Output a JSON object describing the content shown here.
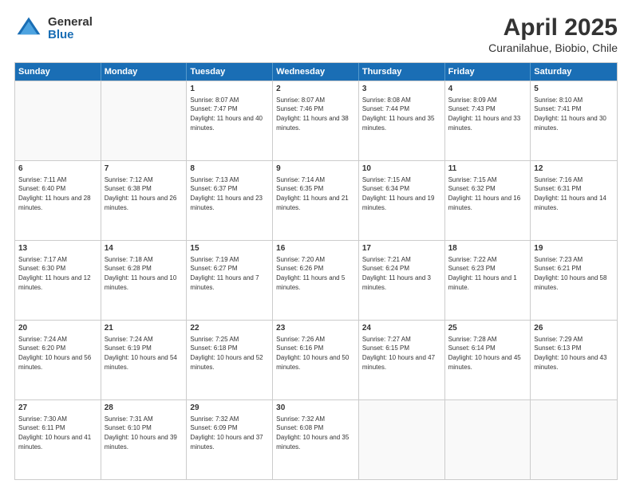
{
  "logo": {
    "general": "General",
    "blue": "Blue"
  },
  "title": "April 2025",
  "subtitle": "Curanilahue, Biobio, Chile",
  "header_days": [
    "Sunday",
    "Monday",
    "Tuesday",
    "Wednesday",
    "Thursday",
    "Friday",
    "Saturday"
  ],
  "weeks": [
    [
      {
        "day": "",
        "info": ""
      },
      {
        "day": "",
        "info": ""
      },
      {
        "day": "1",
        "info": "Sunrise: 8:07 AM\nSunset: 7:47 PM\nDaylight: 11 hours and 40 minutes."
      },
      {
        "day": "2",
        "info": "Sunrise: 8:07 AM\nSunset: 7:46 PM\nDaylight: 11 hours and 38 minutes."
      },
      {
        "day": "3",
        "info": "Sunrise: 8:08 AM\nSunset: 7:44 PM\nDaylight: 11 hours and 35 minutes."
      },
      {
        "day": "4",
        "info": "Sunrise: 8:09 AM\nSunset: 7:43 PM\nDaylight: 11 hours and 33 minutes."
      },
      {
        "day": "5",
        "info": "Sunrise: 8:10 AM\nSunset: 7:41 PM\nDaylight: 11 hours and 30 minutes."
      }
    ],
    [
      {
        "day": "6",
        "info": "Sunrise: 7:11 AM\nSunset: 6:40 PM\nDaylight: 11 hours and 28 minutes."
      },
      {
        "day": "7",
        "info": "Sunrise: 7:12 AM\nSunset: 6:38 PM\nDaylight: 11 hours and 26 minutes."
      },
      {
        "day": "8",
        "info": "Sunrise: 7:13 AM\nSunset: 6:37 PM\nDaylight: 11 hours and 23 minutes."
      },
      {
        "day": "9",
        "info": "Sunrise: 7:14 AM\nSunset: 6:35 PM\nDaylight: 11 hours and 21 minutes."
      },
      {
        "day": "10",
        "info": "Sunrise: 7:15 AM\nSunset: 6:34 PM\nDaylight: 11 hours and 19 minutes."
      },
      {
        "day": "11",
        "info": "Sunrise: 7:15 AM\nSunset: 6:32 PM\nDaylight: 11 hours and 16 minutes."
      },
      {
        "day": "12",
        "info": "Sunrise: 7:16 AM\nSunset: 6:31 PM\nDaylight: 11 hours and 14 minutes."
      }
    ],
    [
      {
        "day": "13",
        "info": "Sunrise: 7:17 AM\nSunset: 6:30 PM\nDaylight: 11 hours and 12 minutes."
      },
      {
        "day": "14",
        "info": "Sunrise: 7:18 AM\nSunset: 6:28 PM\nDaylight: 11 hours and 10 minutes."
      },
      {
        "day": "15",
        "info": "Sunrise: 7:19 AM\nSunset: 6:27 PM\nDaylight: 11 hours and 7 minutes."
      },
      {
        "day": "16",
        "info": "Sunrise: 7:20 AM\nSunset: 6:26 PM\nDaylight: 11 hours and 5 minutes."
      },
      {
        "day": "17",
        "info": "Sunrise: 7:21 AM\nSunset: 6:24 PM\nDaylight: 11 hours and 3 minutes."
      },
      {
        "day": "18",
        "info": "Sunrise: 7:22 AM\nSunset: 6:23 PM\nDaylight: 11 hours and 1 minute."
      },
      {
        "day": "19",
        "info": "Sunrise: 7:23 AM\nSunset: 6:21 PM\nDaylight: 10 hours and 58 minutes."
      }
    ],
    [
      {
        "day": "20",
        "info": "Sunrise: 7:24 AM\nSunset: 6:20 PM\nDaylight: 10 hours and 56 minutes."
      },
      {
        "day": "21",
        "info": "Sunrise: 7:24 AM\nSunset: 6:19 PM\nDaylight: 10 hours and 54 minutes."
      },
      {
        "day": "22",
        "info": "Sunrise: 7:25 AM\nSunset: 6:18 PM\nDaylight: 10 hours and 52 minutes."
      },
      {
        "day": "23",
        "info": "Sunrise: 7:26 AM\nSunset: 6:16 PM\nDaylight: 10 hours and 50 minutes."
      },
      {
        "day": "24",
        "info": "Sunrise: 7:27 AM\nSunset: 6:15 PM\nDaylight: 10 hours and 47 minutes."
      },
      {
        "day": "25",
        "info": "Sunrise: 7:28 AM\nSunset: 6:14 PM\nDaylight: 10 hours and 45 minutes."
      },
      {
        "day": "26",
        "info": "Sunrise: 7:29 AM\nSunset: 6:13 PM\nDaylight: 10 hours and 43 minutes."
      }
    ],
    [
      {
        "day": "27",
        "info": "Sunrise: 7:30 AM\nSunset: 6:11 PM\nDaylight: 10 hours and 41 minutes."
      },
      {
        "day": "28",
        "info": "Sunrise: 7:31 AM\nSunset: 6:10 PM\nDaylight: 10 hours and 39 minutes."
      },
      {
        "day": "29",
        "info": "Sunrise: 7:32 AM\nSunset: 6:09 PM\nDaylight: 10 hours and 37 minutes."
      },
      {
        "day": "30",
        "info": "Sunrise: 7:32 AM\nSunset: 6:08 PM\nDaylight: 10 hours and 35 minutes."
      },
      {
        "day": "",
        "info": ""
      },
      {
        "day": "",
        "info": ""
      },
      {
        "day": "",
        "info": ""
      }
    ]
  ]
}
